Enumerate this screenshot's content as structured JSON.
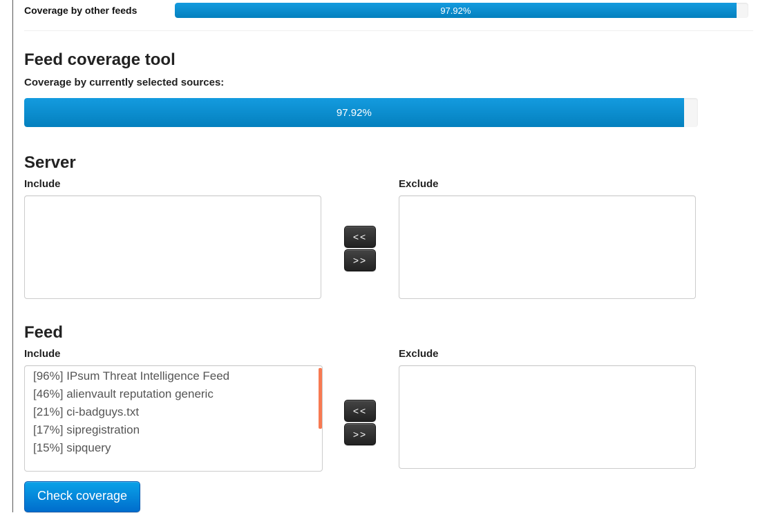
{
  "top": {
    "label": "Coverage by other feeds",
    "percent_text": "97.92%",
    "percent_width": "97.92%"
  },
  "tool": {
    "title": "Feed coverage tool",
    "subhead": "Coverage by currently selected sources:",
    "percent_text": "97.92%",
    "percent_width": "97.92%"
  },
  "server": {
    "title": "Server",
    "include_label": "Include",
    "exclude_label": "Exclude",
    "btn_left": "<<",
    "btn_right": ">>"
  },
  "feed": {
    "title": "Feed",
    "include_label": "Include",
    "exclude_label": "Exclude",
    "btn_left": "<<",
    "btn_right": ">>",
    "items": [
      "[96%] IPsum Threat Intelligence Feed",
      "[46%] alienvault reputation generic",
      "[21%] ci-badguys.txt",
      "[17%] sipregistration",
      "[15%] sipquery"
    ]
  },
  "check_button": "Check coverage"
}
